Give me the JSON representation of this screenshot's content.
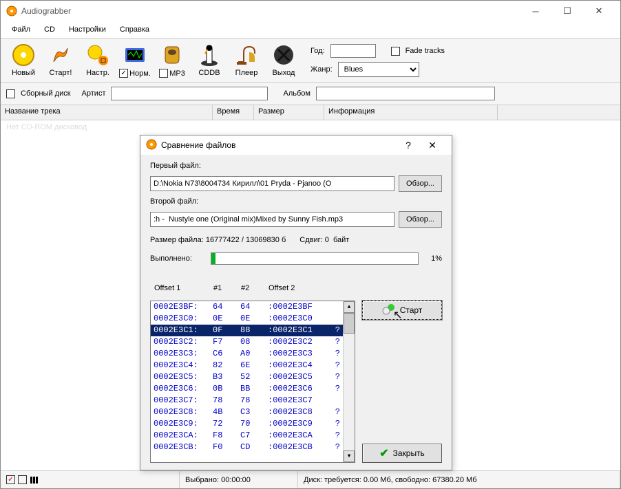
{
  "app": {
    "title": "Audiograbber"
  },
  "menu": [
    "Файл",
    "CD",
    "Настройки",
    "Справка"
  ],
  "toolbar": [
    {
      "name": "new",
      "label": "Новый",
      "chk": null
    },
    {
      "name": "start",
      "label": "Старт!",
      "chk": null
    },
    {
      "name": "settings",
      "label": "Настр.",
      "chk": null
    },
    {
      "name": "norm",
      "label": "Норм.",
      "chk": true
    },
    {
      "name": "mp3",
      "label": "MP3",
      "chk": false
    },
    {
      "name": "cddb",
      "label": "CDDB",
      "chk": null
    },
    {
      "name": "player",
      "label": "Плеер",
      "chk": null
    },
    {
      "name": "exit",
      "label": "Выход",
      "chk": null
    }
  ],
  "right": {
    "year_label": "Год:",
    "year": "",
    "fade_label": "Fade tracks",
    "fade_checked": false,
    "genre_label": "Жанр:",
    "genre": "Blues"
  },
  "row2": {
    "compilation_label": "Сборный диск",
    "compilation_checked": false,
    "artist_label": "Артист",
    "artist": "",
    "album_label": "Альбом",
    "album": ""
  },
  "cols": {
    "track": "Название трека",
    "time": "Время",
    "size": "Размер",
    "info": "Информация"
  },
  "ghost": "Нет CD-ROM дисковод",
  "status": {
    "selected_label": "Выбрано:",
    "selected": "00:00:00",
    "disk": "Диск: требуется: 0.00 Мб, свободно: 67380.20 Мб"
  },
  "dialog": {
    "title": "Сравнение файлов",
    "help": "?",
    "file1_label": "Первый файл:",
    "file1": "D:\\Nokia N73\\8004734 Кирилл\\01 Pryda - Pjanoo (O",
    "file2_label": "Второй файл:",
    "file2": ":h -  Nustyle one (Original mix)Mixed by Sunny Fish.mp3",
    "browse": "Обзор...",
    "size_label": "Размер файла:",
    "size": "16777422 / 13069830 б",
    "shift_label": "Сдвиг:",
    "shift": "0",
    "bytes": "байт",
    "done_label": "Выполнено:",
    "percent": "1%",
    "progress_pct": 2,
    "headers": {
      "o1": "Offset 1",
      "h1": "#1",
      "h2": "#2",
      "o2": "Offset 2"
    },
    "rows": [
      {
        "o1": "0002E3BF:",
        "v1": "64",
        "v2": "64",
        "o2": ":0002E3BF",
        "f": "",
        "sel": false
      },
      {
        "o1": "0002E3C0:",
        "v1": "0E",
        "v2": "0E",
        "o2": ":0002E3C0",
        "f": "",
        "sel": false
      },
      {
        "o1": "0002E3C1:",
        "v1": "0F",
        "v2": "88",
        "o2": ":0002E3C1",
        "f": "?",
        "sel": true
      },
      {
        "o1": "0002E3C2:",
        "v1": "F7",
        "v2": "08",
        "o2": ":0002E3C2",
        "f": "?",
        "sel": false
      },
      {
        "o1": "0002E3C3:",
        "v1": "C6",
        "v2": "A0",
        "o2": ":0002E3C3",
        "f": "?",
        "sel": false
      },
      {
        "o1": "0002E3C4:",
        "v1": "82",
        "v2": "6E",
        "o2": ":0002E3C4",
        "f": "?",
        "sel": false
      },
      {
        "o1": "0002E3C5:",
        "v1": "B3",
        "v2": "52",
        "o2": ":0002E3C5",
        "f": "?",
        "sel": false
      },
      {
        "o1": "0002E3C6:",
        "v1": "0B",
        "v2": "BB",
        "o2": ":0002E3C6",
        "f": "?",
        "sel": false
      },
      {
        "o1": "0002E3C7:",
        "v1": "78",
        "v2": "78",
        "o2": ":0002E3C7",
        "f": "",
        "sel": false
      },
      {
        "o1": "0002E3C8:",
        "v1": "4B",
        "v2": "C3",
        "o2": ":0002E3C8",
        "f": "?",
        "sel": false
      },
      {
        "o1": "0002E3C9:",
        "v1": "72",
        "v2": "70",
        "o2": ":0002E3C9",
        "f": "?",
        "sel": false
      },
      {
        "o1": "0002E3CA:",
        "v1": "F8",
        "v2": "C7",
        "o2": ":0002E3CA",
        "f": "?",
        "sel": false
      },
      {
        "o1": "0002E3CB:",
        "v1": "F0",
        "v2": "CD",
        "o2": ":0002E3CB",
        "f": "?",
        "sel": false
      }
    ],
    "start": "Старт",
    "close": "Закрыть"
  }
}
